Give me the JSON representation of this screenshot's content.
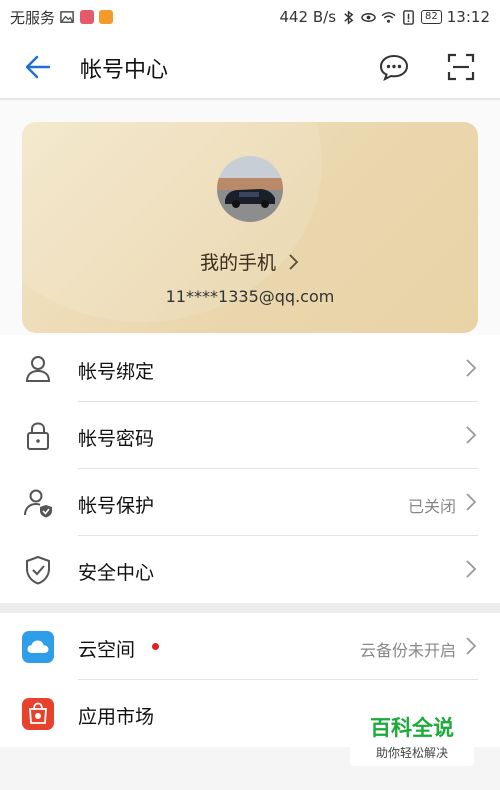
{
  "status_bar": {
    "carrier": "无服务",
    "net_speed": "442 B/s",
    "battery": "82",
    "time": "13:12"
  },
  "header": {
    "title": "帐号中心"
  },
  "profile": {
    "name": "我的手机",
    "email": "11****1335@qq.com"
  },
  "menu": [
    {
      "label": "帐号绑定",
      "value": ""
    },
    {
      "label": "帐号密码",
      "value": ""
    },
    {
      "label": "帐号保护",
      "value": "已关闭"
    },
    {
      "label": "安全中心",
      "value": ""
    }
  ],
  "services": [
    {
      "label": "云空间",
      "value": "云备份未开启",
      "has_dot": true
    },
    {
      "label": "应用市场",
      "value": ""
    }
  ],
  "watermark": {
    "title": "百科全说",
    "subtitle": "助你轻松解决"
  },
  "colors": {
    "accent": "#1f6fd1",
    "card_bg": "#ead7ae",
    "dot_red": "#e02020",
    "watermark_green": "#1bab3a"
  }
}
